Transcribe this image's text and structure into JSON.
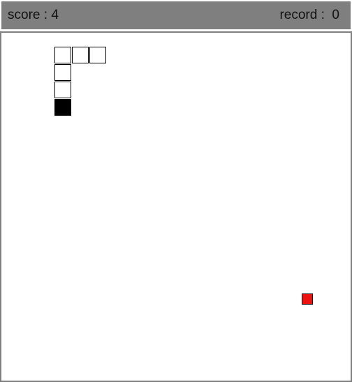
{
  "scoreboard": {
    "score_label": "score :",
    "score_value": "4",
    "record_label": "record :",
    "record_value": "0"
  },
  "game": {
    "grid": {
      "cols": 20,
      "rows": 20
    },
    "snake": {
      "head": {
        "col": 3,
        "row": 4
      },
      "body": [
        {
          "col": 3,
          "row": 3
        },
        {
          "col": 3,
          "row": 2
        },
        {
          "col": 3,
          "row": 1
        },
        {
          "col": 4,
          "row": 1
        },
        {
          "col": 5,
          "row": 1
        }
      ]
    },
    "food": {
      "col": 17,
      "row": 15
    },
    "colors": {
      "snake_head": "#000000",
      "snake_body": "#ffffff",
      "food": "#ee1111",
      "header_bg": "#7f7f7f",
      "board_border": "#7f7f7f"
    }
  }
}
